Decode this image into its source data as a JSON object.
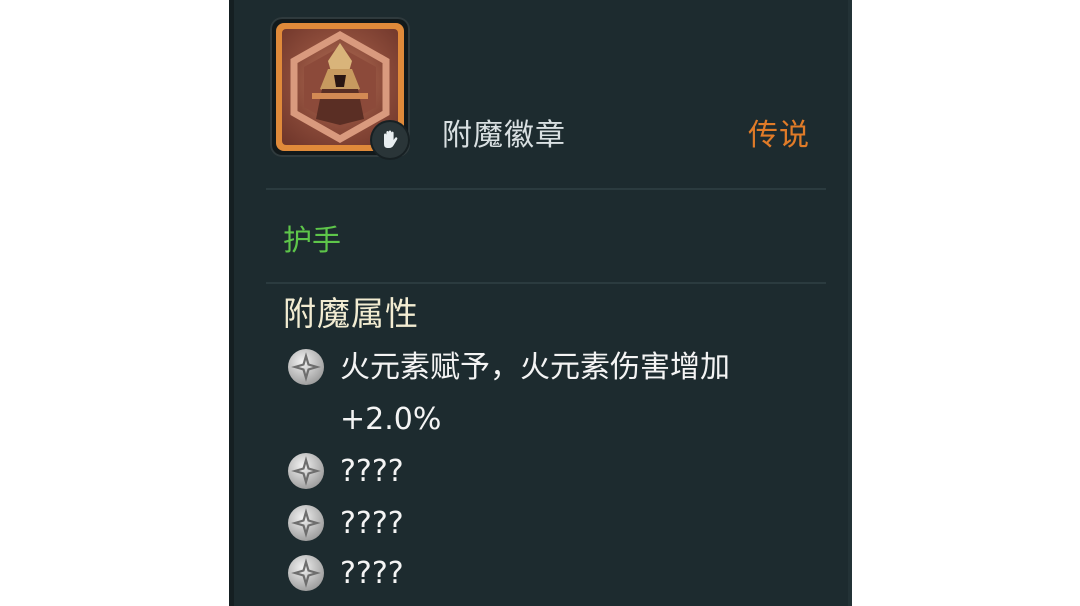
{
  "item": {
    "name": "附魔徽章",
    "rarity": "传说",
    "type": "护手",
    "icon": "enchant-badge-icon",
    "slot_icon": "gauntlet-icon"
  },
  "attributes": {
    "title": "附魔属性",
    "entries": [
      {
        "line1": "火元素赋予，火元素伤害增加",
        "line2": "+2.0%"
      },
      {
        "line1": "????"
      },
      {
        "line1": "????"
      },
      {
        "line1": "????"
      }
    ]
  },
  "colors": {
    "panel_bg": "#1d2b2f",
    "rarity_legendary": "#e07b28",
    "item_type": "#5ec64a",
    "section_title": "#f2ecd2",
    "icon_frame": "#e08a3a"
  }
}
